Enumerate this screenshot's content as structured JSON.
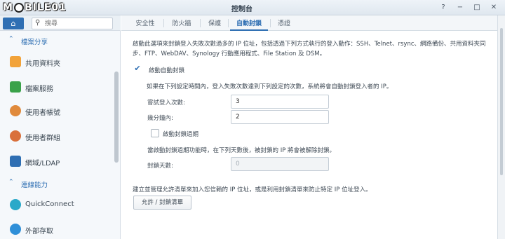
{
  "logo": {
    "text_left": "M",
    "text_right": "BILE",
    "suffix": "01"
  },
  "window": {
    "title": "控制台",
    "help": "?",
    "minimize": "−",
    "maximize": "□",
    "close": "✕"
  },
  "sidebar": {
    "home_glyph": "⌂",
    "search_placeholder": "搜尋",
    "sections": [
      {
        "label": "檔案分享"
      },
      {
        "label": "連線能力"
      }
    ],
    "items": [
      {
        "label": "共用資料夾",
        "color": "#f2a33a",
        "icon": "shared-folder-icon"
      },
      {
        "label": "檔案服務",
        "color": "#3aa24a",
        "icon": "file-services-icon"
      },
      {
        "label": "使用者帳號",
        "color": "#e08a3c",
        "icon": "user-icon"
      },
      {
        "label": "使用者群組",
        "color": "#d9703c",
        "icon": "group-icon"
      },
      {
        "label": "網域/LDAP",
        "color": "#2f6fb3",
        "icon": "domain-ldap-icon"
      },
      {
        "label": "QuickConnect",
        "color": "#2aa9c9",
        "icon": "quickconnect-icon"
      },
      {
        "label": "外部存取",
        "color": "#2f8fd8",
        "icon": "external-access-icon"
      }
    ]
  },
  "tabs": [
    {
      "label": "安全性"
    },
    {
      "label": "防火牆"
    },
    {
      "label": "保護"
    },
    {
      "label": "自動封鎖"
    },
    {
      "label": "憑證"
    }
  ],
  "content": {
    "description": "啟動此選項來封鎖登入失敗次數過多的 IP 位址，包括透過下列方式執行的登入動作：SSH、Telnet、rsync、網路備份、共用資料夾同步、FTP、WebDAV、Synology 行動應用程式、File Station 及 DSM。",
    "enable_autoblock": "啟動自動封鎖",
    "check_mark": "✔",
    "block_rule": "如果在下列設定時間內，登入失敗次數達到下列設定的次數，系統將會自動封鎖登入者的 IP。",
    "login_attempts_label": "嘗試登入次數:",
    "login_attempts_value": "3",
    "within_minutes_label": "幾分鐘內:",
    "within_minutes_value": "2",
    "enable_expiration": "啟動封鎖過期",
    "expiration_rule": "當啟動封鎖過期功能時，在下列天數後，被封鎖的 IP 將會被解除封鎖。",
    "unblock_days_label": "封鎖天數:",
    "unblock_days_value": "0",
    "allow_block_desc": "建立並管理允許清單來加入您信賴的 IP 位址，或是利用封鎖清單來防止特定 IP 位址登入。",
    "allow_block_button": "允許 / 封鎖清單"
  }
}
